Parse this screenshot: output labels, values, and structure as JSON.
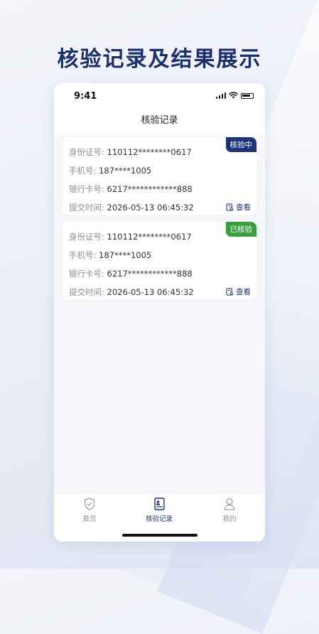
{
  "promo": {
    "title": "核验记录及结果展示"
  },
  "status_bar": {
    "time": "9:41"
  },
  "nav": {
    "title": "核验记录"
  },
  "records": [
    {
      "id_label": "身份证号:",
      "id_value": "110112********0617",
      "phone_label": "手机号:",
      "phone_value": "187****1005",
      "bank_label": "银行卡号:",
      "bank_value": "6217************888",
      "time_label": "提交时间:",
      "time_value": "2026-05-13 06:45:32",
      "status": "核验中",
      "status_color": "#1f3476",
      "view_label": "查看"
    },
    {
      "id_label": "身份证号:",
      "id_value": "110112********0617",
      "phone_label": "手机号:",
      "phone_value": "187****1005",
      "bank_label": "银行卡号:",
      "bank_value": "6217************888",
      "time_label": "提交时间:",
      "time_value": "2026-05-13 06:45:32",
      "status": "已核验",
      "status_color": "#3a9f3f",
      "view_label": "查看"
    }
  ],
  "tabbar": {
    "items": [
      {
        "label": "首页",
        "icon": "shield-check-icon"
      },
      {
        "label": "核验记录",
        "icon": "id-card-icon",
        "active": true
      },
      {
        "label": "我的",
        "icon": "user-icon"
      }
    ]
  },
  "colors": {
    "accent": "#1f3476",
    "success": "#3a9f3f",
    "title": "#1d2f6b"
  }
}
